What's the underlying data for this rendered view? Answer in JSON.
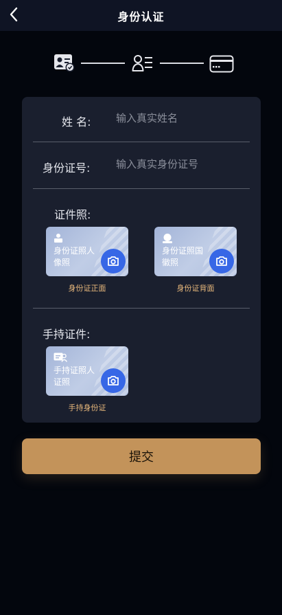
{
  "header": {
    "title": "身份认证",
    "back_icon": "chevron-left-icon"
  },
  "steps": [
    {
      "icon": "id-card-verified-icon"
    },
    {
      "icon": "person-info-icon"
    },
    {
      "icon": "bank-card-icon"
    }
  ],
  "form": {
    "name": {
      "label": "姓 名:",
      "placeholder": "输入真实姓名",
      "value": ""
    },
    "id_number": {
      "label": "身份证号:",
      "placeholder": "输入真实身份证号",
      "value": ""
    }
  },
  "id_photos": {
    "label": "证件照:",
    "front": {
      "text": "身份证照人像照",
      "caption": "身份证正面",
      "icon": "person-icon"
    },
    "back": {
      "text": "身份证照国徽照",
      "caption": "身份证背面",
      "icon": "emblem-icon"
    }
  },
  "handheld": {
    "label": "手持证件:",
    "photo": {
      "text": "手持证照人证照",
      "caption": "手持身份证",
      "icon": "handheld-id-icon"
    }
  },
  "submit_label": "提交",
  "colors": {
    "accent": "#c3935a",
    "camera": "#3767e6",
    "caption": "#e9b97c",
    "card_bg": "#1a1f2e",
    "page_bg": "#03060d"
  }
}
